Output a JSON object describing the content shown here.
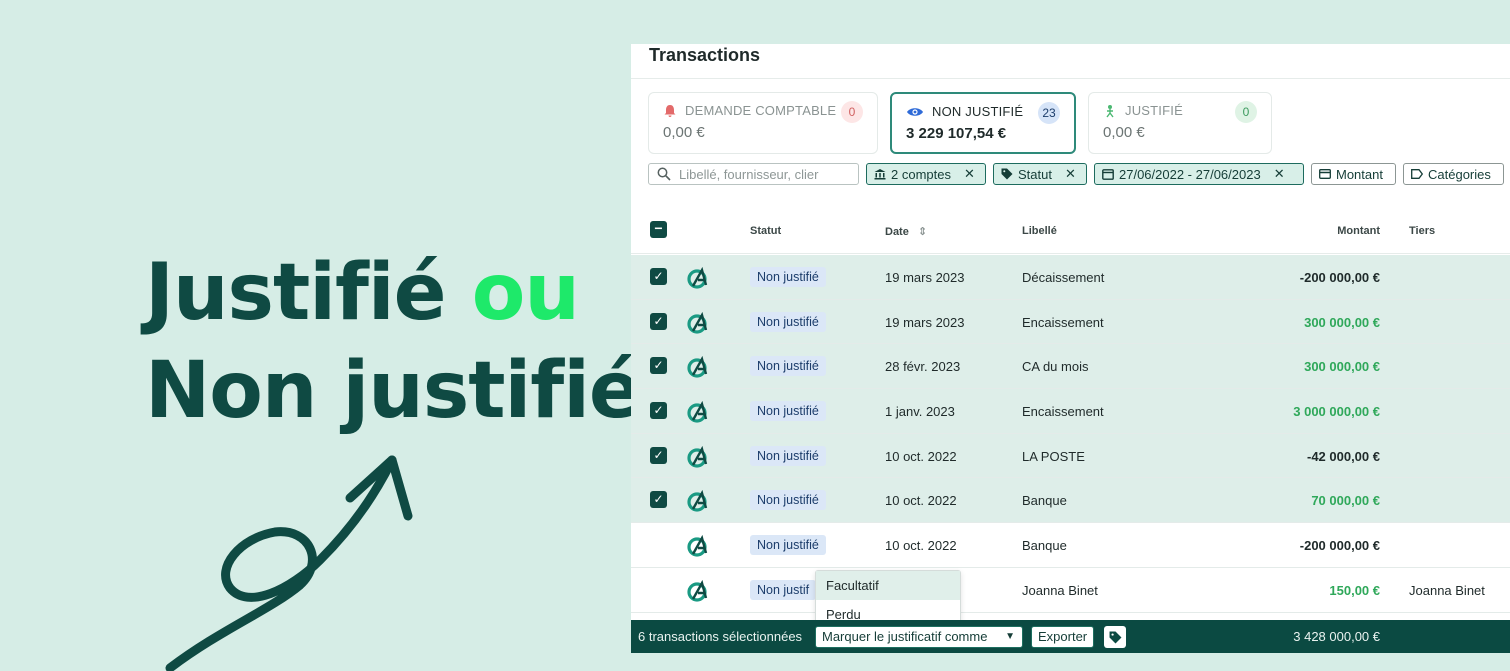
{
  "hero": {
    "line1_a": "Justifié",
    "line1_b": "ou",
    "line2": "Non justifié"
  },
  "header": {
    "title": "Transactions"
  },
  "cards": [
    {
      "label": "DEMANDE COMPTABLE",
      "count": "0",
      "amount": "0,00 €",
      "color": "#e36a6a",
      "count_bg": "#fde6e6"
    },
    {
      "label": "NON JUSTIFIÉ",
      "count": "23",
      "amount": "3 229 107,54 €",
      "color": "#2f6bd8",
      "count_bg": "#d6e4f8"
    },
    {
      "label": "JUSTIFIÉ",
      "count": "0",
      "amount": "0,00 €",
      "color": "#4bb872",
      "count_bg": "#dff3e5"
    }
  ],
  "search": {
    "placeholder": "Libellé, fournisseur, clier"
  },
  "filters": {
    "accounts": "2 comptes",
    "status": "Statut",
    "dates": "27/06/2022 - 27/06/2023",
    "amount": "Montant",
    "categories": "Catégories"
  },
  "table": {
    "headers": {
      "status": "Statut",
      "date": "Date",
      "label": "Libellé",
      "amount": "Montant",
      "third": "Tiers"
    },
    "rows": [
      {
        "status": "Non justifié",
        "date": "19 mars 2023",
        "label": "Décaissement",
        "amount": "-200 000,00 €",
        "tiers": ""
      },
      {
        "status": "Non justifié",
        "date": "19 mars 2023",
        "label": "Encaissement",
        "amount": "300 000,00 €",
        "tiers": ""
      },
      {
        "status": "Non justifié",
        "date": "28 févr. 2023",
        "label": "CA du mois",
        "amount": "300 000,00 €",
        "tiers": ""
      },
      {
        "status": "Non justifié",
        "date": "1 janv. 2023",
        "label": "Encaissement",
        "amount": "3 000 000,00 €",
        "tiers": ""
      },
      {
        "status": "Non justifié",
        "date": "10 oct. 2022",
        "label": "LA POSTE",
        "amount": "-42 000,00 €",
        "tiers": ""
      },
      {
        "status": "Non justifié",
        "date": "10 oct. 2022",
        "label": "Banque",
        "amount": "70 000,00 €",
        "tiers": ""
      },
      {
        "status": "Non justifié",
        "date": "10 oct. 2022",
        "label": "Banque",
        "amount": "-200 000,00 €",
        "tiers": ""
      },
      {
        "status": "Non justif",
        "date": "",
        "label": "Joanna Binet",
        "amount": "150,00 €",
        "tiers": "Joanna Binet"
      }
    ]
  },
  "dropdown": {
    "items": [
      "Facultatif",
      "Perdu"
    ]
  },
  "footer": {
    "selected": "6 transactions sélectionnées",
    "mark_as": "Marquer le justificatif comme",
    "export": "Exporter",
    "total": "3 428 000,00 €"
  }
}
